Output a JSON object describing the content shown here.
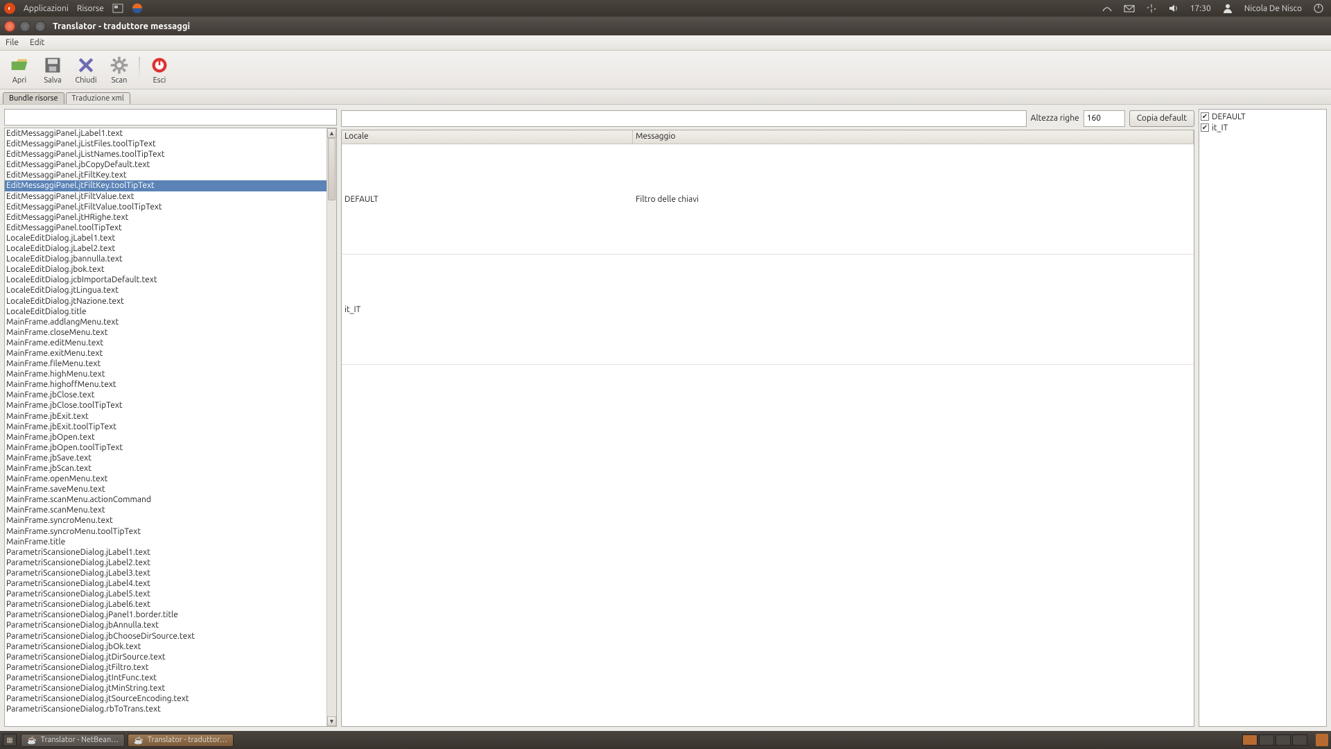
{
  "gnome": {
    "app_menu": "Applicazioni",
    "places_menu": "Risorse",
    "clock": "17:30",
    "user": "Nicola De Nisco"
  },
  "window": {
    "title": "Translator - traduttore messaggi"
  },
  "menubar": {
    "file": "File",
    "edit": "Edit"
  },
  "toolbar": {
    "open": "Apri",
    "save": "Salva",
    "close": "Chiudi",
    "scan": "Scan",
    "exit": "Esci"
  },
  "tabs": {
    "bundle": "Bundle risorse",
    "xml": "Traduzione xml"
  },
  "row_height": {
    "label": "Altezza righe",
    "value": "160"
  },
  "copy_default_btn": "Copia default",
  "table": {
    "col_locale": "Locale",
    "col_msg": "Messaggio",
    "rows": [
      {
        "locale": "DEFAULT",
        "msg": "Filtro delle chiavi"
      },
      {
        "locale": "it_IT",
        "msg": ""
      }
    ]
  },
  "locales": [
    {
      "name": "DEFAULT",
      "checked": true
    },
    {
      "name": "it_IT",
      "checked": true
    }
  ],
  "selected_index": 5,
  "keys": [
    "EditMessaggiPanel.jLabel1.text",
    "EditMessaggiPanel.jListFiles.toolTipText",
    "EditMessaggiPanel.jListNames.toolTipText",
    "EditMessaggiPanel.jbCopyDefault.text",
    "EditMessaggiPanel.jtFiltKey.text",
    "EditMessaggiPanel.jtFiltKey.toolTipText",
    "EditMessaggiPanel.jtFiltValue.text",
    "EditMessaggiPanel.jtFiltValue.toolTipText",
    "EditMessaggiPanel.jtHRighe.text",
    "EditMessaggiPanel.toolTipText",
    "LocaleEditDialog.jLabel1.text",
    "LocaleEditDialog.jLabel2.text",
    "LocaleEditDialog.jbannulla.text",
    "LocaleEditDialog.jbok.text",
    "LocaleEditDialog.jcbImportaDefault.text",
    "LocaleEditDialog.jtLingua.text",
    "LocaleEditDialog.jtNazione.text",
    "LocaleEditDialog.title",
    "MainFrame.addlangMenu.text",
    "MainFrame.closeMenu.text",
    "MainFrame.editMenu.text",
    "MainFrame.exitMenu.text",
    "MainFrame.fileMenu.text",
    "MainFrame.highMenu.text",
    "MainFrame.highoffMenu.text",
    "MainFrame.jbClose.text",
    "MainFrame.jbClose.toolTipText",
    "MainFrame.jbExit.text",
    "MainFrame.jbExit.toolTipText",
    "MainFrame.jbOpen.text",
    "MainFrame.jbOpen.toolTipText",
    "MainFrame.jbSave.text",
    "MainFrame.jbScan.text",
    "MainFrame.openMenu.text",
    "MainFrame.saveMenu.text",
    "MainFrame.scanMenu.actionCommand",
    "MainFrame.scanMenu.text",
    "MainFrame.syncroMenu.text",
    "MainFrame.syncroMenu.toolTipText",
    "MainFrame.title",
    "ParametriScansioneDialog.jLabel1.text",
    "ParametriScansioneDialog.jLabel2.text",
    "ParametriScansioneDialog.jLabel3.text",
    "ParametriScansioneDialog.jLabel4.text",
    "ParametriScansioneDialog.jLabel5.text",
    "ParametriScansioneDialog.jLabel6.text",
    "ParametriScansioneDialog.jPanel1.border.title",
    "ParametriScansioneDialog.jbAnnulla.text",
    "ParametriScansioneDialog.jbChooseDirSource.text",
    "ParametriScansioneDialog.jbOk.text",
    "ParametriScansioneDialog.jtDirSource.text",
    "ParametriScansioneDialog.jtFiltro.text",
    "ParametriScansioneDialog.jtIntFunc.text",
    "ParametriScansioneDialog.jtMinString.text",
    "ParametriScansioneDialog.jtSourceEncoding.text",
    "ParametriScansioneDialog.rbToTrans.text"
  ],
  "taskbar": {
    "btn1": "Translator - NetBean…",
    "btn2": "Translator - traduttor…"
  }
}
